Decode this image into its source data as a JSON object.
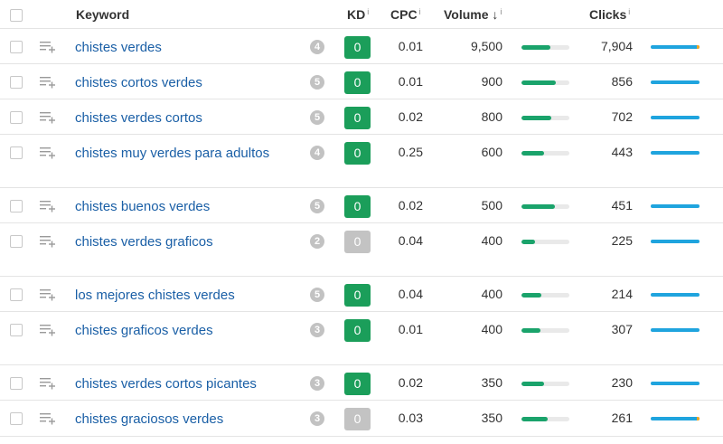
{
  "colors": {
    "link": "#1a5fa6",
    "kd_green": "#1b9e5a",
    "kd_gray": "#c3c3c3",
    "volume_bar": "#1aa36b",
    "clicks_bar": "#1fa4de",
    "clicks_paid": "#f5a623"
  },
  "header": {
    "keyword": "Keyword",
    "kd": "KD",
    "cpc": "CPC",
    "volume": "Volume",
    "sort_arrow": "↓",
    "clicks": "Clicks",
    "info": "i"
  },
  "rows": [
    {
      "keyword": "chistes verdes",
      "serp": "4",
      "kd": "0",
      "kd_level": "green",
      "cpc": "0.01",
      "volume": "9,500",
      "volume_fill": 0.6,
      "clicks": "7,904",
      "paid": true
    },
    {
      "keyword": "chistes cortos verdes",
      "serp": "5",
      "kd": "0",
      "kd_level": "green",
      "cpc": "0.01",
      "volume": "900",
      "volume_fill": 0.72,
      "clicks": "856",
      "paid": false
    },
    {
      "keyword": "chistes verdes cortos",
      "serp": "5",
      "kd": "0",
      "kd_level": "green",
      "cpc": "0.02",
      "volume": "800",
      "volume_fill": 0.63,
      "clicks": "702",
      "paid": false
    },
    {
      "keyword": "chistes muy verdes para adultos",
      "serp": "4",
      "kd": "0",
      "kd_level": "green",
      "cpc": "0.25",
      "volume": "600",
      "volume_fill": 0.47,
      "clicks": "443",
      "paid": false
    },
    {
      "keyword": "chistes buenos verdes",
      "serp": "5",
      "kd": "0",
      "kd_level": "green",
      "cpc": "0.02",
      "volume": "500",
      "volume_fill": 0.7,
      "clicks": "451",
      "paid": false
    },
    {
      "keyword": "chistes verdes graficos",
      "serp": "2",
      "kd": "0",
      "kd_level": "gray",
      "cpc": "0.04",
      "volume": "400",
      "volume_fill": 0.28,
      "clicks": "225",
      "paid": false
    },
    {
      "keyword": "los mejores chistes verdes",
      "serp": "5",
      "kd": "0",
      "kd_level": "green",
      "cpc": "0.04",
      "volume": "400",
      "volume_fill": 0.42,
      "clicks": "214",
      "paid": false
    },
    {
      "keyword": "chistes graficos verdes",
      "serp": "3",
      "kd": "0",
      "kd_level": "green",
      "cpc": "0.01",
      "volume": "400",
      "volume_fill": 0.4,
      "clicks": "307",
      "paid": false
    },
    {
      "keyword": "chistes verdes cortos picantes",
      "serp": "3",
      "kd": "0",
      "kd_level": "green",
      "cpc": "0.02",
      "volume": "350",
      "volume_fill": 0.47,
      "clicks": "230",
      "paid": false
    },
    {
      "keyword": "chistes graciosos verdes",
      "serp": "3",
      "kd": "0",
      "kd_level": "gray",
      "cpc": "0.03",
      "volume": "350",
      "volume_fill": 0.55,
      "clicks": "261",
      "paid": true
    }
  ]
}
